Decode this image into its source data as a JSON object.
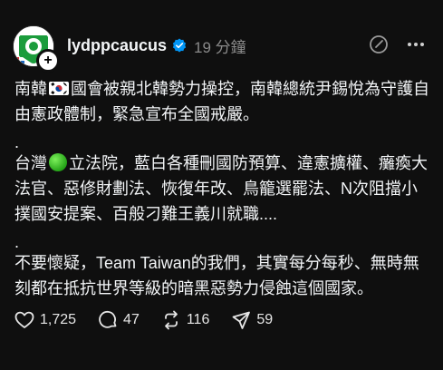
{
  "post": {
    "username": "lydppcaucus",
    "time": "19 分鐘",
    "paragraphs": [
      {
        "before": "南韓",
        "icon": "south-korea-flag-icon",
        "after": "國會被親北韓勢力操控，南韓總統尹錫悅為守護自由憲政體制，緊急宣布全國戒嚴。"
      },
      {
        "before": "台灣",
        "icon": "green-circle-icon",
        "after": "立法院，藍白各種刪國防預算、違憲擴權、癱瘓大法官、惡修財劃法、恢復年改、鳥籠選罷法、N次阻擋小撲國安提案、百般刁難王義川就職...."
      },
      {
        "before": "",
        "icon": "",
        "after": "不要懷疑，Team Taiwan的我們，其實每分每秒、無時無刻都在抵抗世界等級的暗黑惡勢力侵蝕這個國家。"
      }
    ],
    "separator": "."
  },
  "actions": {
    "likes": "1,725",
    "comments": "47",
    "reposts": "116",
    "shares": "59"
  },
  "colors": {
    "background": "#0f0f0f",
    "text": "#f3f5f7",
    "muted": "#8a8a8a",
    "verified": "#0095f6",
    "dpp_green": "#1b9c3c"
  }
}
